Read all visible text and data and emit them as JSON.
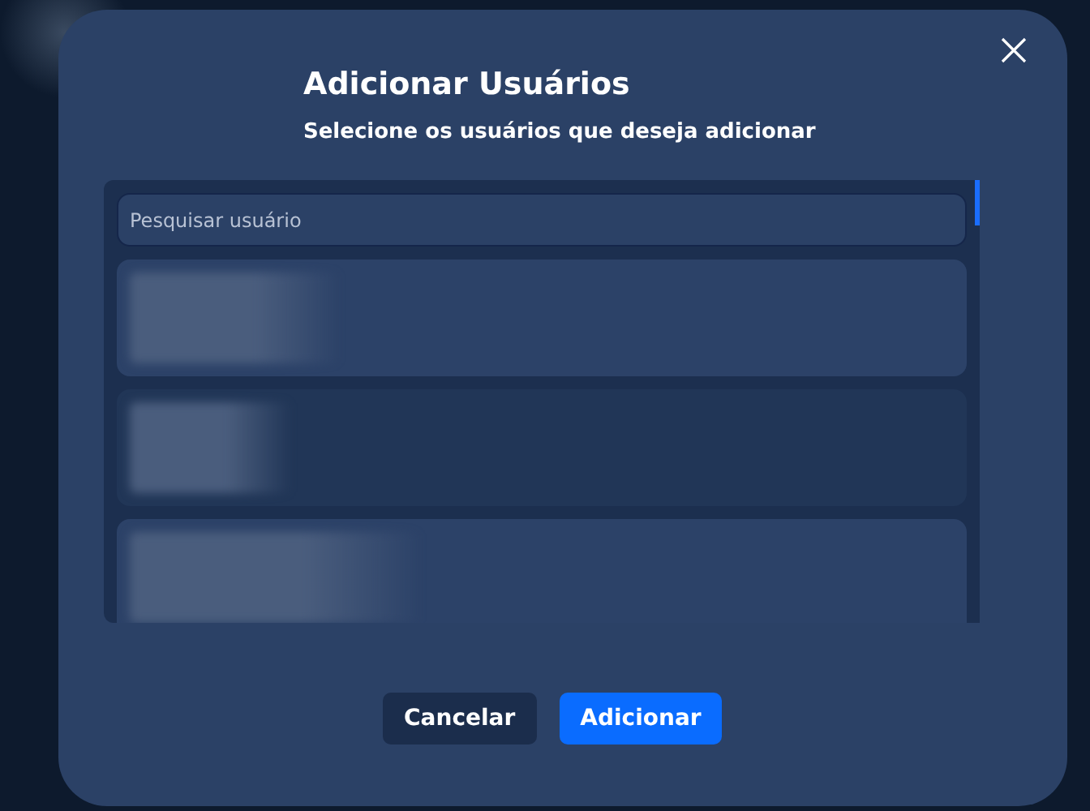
{
  "dialog": {
    "title": "Adicionar Usuários",
    "subtitle": "Selecione os usuários que deseja adicionar"
  },
  "search": {
    "placeholder": "Pesquisar usuário"
  },
  "users": [
    {
      "selected": false
    },
    {
      "selected": true
    },
    {
      "selected": false
    }
  ],
  "buttons": [
    {
      "label": "Cancelar",
      "kind": "secondary"
    },
    {
      "label": "Adicionar",
      "kind": "primary"
    }
  ]
}
